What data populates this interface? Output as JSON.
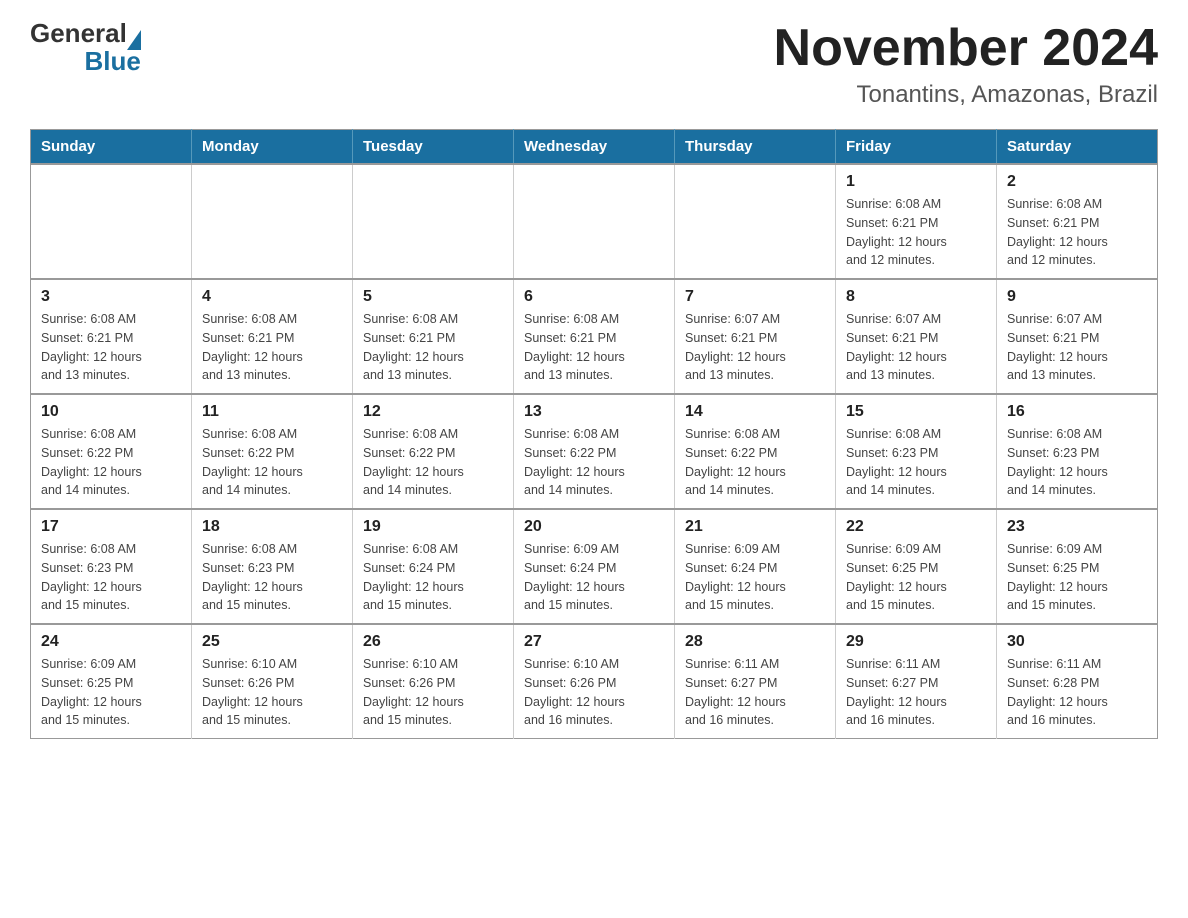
{
  "header": {
    "logo_general": "General",
    "logo_blue": "Blue",
    "title": "November 2024",
    "subtitle": "Tonantins, Amazonas, Brazil"
  },
  "days_of_week": [
    "Sunday",
    "Monday",
    "Tuesday",
    "Wednesday",
    "Thursday",
    "Friday",
    "Saturday"
  ],
  "weeks": [
    [
      {
        "day": "",
        "info": ""
      },
      {
        "day": "",
        "info": ""
      },
      {
        "day": "",
        "info": ""
      },
      {
        "day": "",
        "info": ""
      },
      {
        "day": "",
        "info": ""
      },
      {
        "day": "1",
        "info": "Sunrise: 6:08 AM\nSunset: 6:21 PM\nDaylight: 12 hours\nand 12 minutes."
      },
      {
        "day": "2",
        "info": "Sunrise: 6:08 AM\nSunset: 6:21 PM\nDaylight: 12 hours\nand 12 minutes."
      }
    ],
    [
      {
        "day": "3",
        "info": "Sunrise: 6:08 AM\nSunset: 6:21 PM\nDaylight: 12 hours\nand 13 minutes."
      },
      {
        "day": "4",
        "info": "Sunrise: 6:08 AM\nSunset: 6:21 PM\nDaylight: 12 hours\nand 13 minutes."
      },
      {
        "day": "5",
        "info": "Sunrise: 6:08 AM\nSunset: 6:21 PM\nDaylight: 12 hours\nand 13 minutes."
      },
      {
        "day": "6",
        "info": "Sunrise: 6:08 AM\nSunset: 6:21 PM\nDaylight: 12 hours\nand 13 minutes."
      },
      {
        "day": "7",
        "info": "Sunrise: 6:07 AM\nSunset: 6:21 PM\nDaylight: 12 hours\nand 13 minutes."
      },
      {
        "day": "8",
        "info": "Sunrise: 6:07 AM\nSunset: 6:21 PM\nDaylight: 12 hours\nand 13 minutes."
      },
      {
        "day": "9",
        "info": "Sunrise: 6:07 AM\nSunset: 6:21 PM\nDaylight: 12 hours\nand 13 minutes."
      }
    ],
    [
      {
        "day": "10",
        "info": "Sunrise: 6:08 AM\nSunset: 6:22 PM\nDaylight: 12 hours\nand 14 minutes."
      },
      {
        "day": "11",
        "info": "Sunrise: 6:08 AM\nSunset: 6:22 PM\nDaylight: 12 hours\nand 14 minutes."
      },
      {
        "day": "12",
        "info": "Sunrise: 6:08 AM\nSunset: 6:22 PM\nDaylight: 12 hours\nand 14 minutes."
      },
      {
        "day": "13",
        "info": "Sunrise: 6:08 AM\nSunset: 6:22 PM\nDaylight: 12 hours\nand 14 minutes."
      },
      {
        "day": "14",
        "info": "Sunrise: 6:08 AM\nSunset: 6:22 PM\nDaylight: 12 hours\nand 14 minutes."
      },
      {
        "day": "15",
        "info": "Sunrise: 6:08 AM\nSunset: 6:23 PM\nDaylight: 12 hours\nand 14 minutes."
      },
      {
        "day": "16",
        "info": "Sunrise: 6:08 AM\nSunset: 6:23 PM\nDaylight: 12 hours\nand 14 minutes."
      }
    ],
    [
      {
        "day": "17",
        "info": "Sunrise: 6:08 AM\nSunset: 6:23 PM\nDaylight: 12 hours\nand 15 minutes."
      },
      {
        "day": "18",
        "info": "Sunrise: 6:08 AM\nSunset: 6:23 PM\nDaylight: 12 hours\nand 15 minutes."
      },
      {
        "day": "19",
        "info": "Sunrise: 6:08 AM\nSunset: 6:24 PM\nDaylight: 12 hours\nand 15 minutes."
      },
      {
        "day": "20",
        "info": "Sunrise: 6:09 AM\nSunset: 6:24 PM\nDaylight: 12 hours\nand 15 minutes."
      },
      {
        "day": "21",
        "info": "Sunrise: 6:09 AM\nSunset: 6:24 PM\nDaylight: 12 hours\nand 15 minutes."
      },
      {
        "day": "22",
        "info": "Sunrise: 6:09 AM\nSunset: 6:25 PM\nDaylight: 12 hours\nand 15 minutes."
      },
      {
        "day": "23",
        "info": "Sunrise: 6:09 AM\nSunset: 6:25 PM\nDaylight: 12 hours\nand 15 minutes."
      }
    ],
    [
      {
        "day": "24",
        "info": "Sunrise: 6:09 AM\nSunset: 6:25 PM\nDaylight: 12 hours\nand 15 minutes."
      },
      {
        "day": "25",
        "info": "Sunrise: 6:10 AM\nSunset: 6:26 PM\nDaylight: 12 hours\nand 15 minutes."
      },
      {
        "day": "26",
        "info": "Sunrise: 6:10 AM\nSunset: 6:26 PM\nDaylight: 12 hours\nand 15 minutes."
      },
      {
        "day": "27",
        "info": "Sunrise: 6:10 AM\nSunset: 6:26 PM\nDaylight: 12 hours\nand 16 minutes."
      },
      {
        "day": "28",
        "info": "Sunrise: 6:11 AM\nSunset: 6:27 PM\nDaylight: 12 hours\nand 16 minutes."
      },
      {
        "day": "29",
        "info": "Sunrise: 6:11 AM\nSunset: 6:27 PM\nDaylight: 12 hours\nand 16 minutes."
      },
      {
        "day": "30",
        "info": "Sunrise: 6:11 AM\nSunset: 6:28 PM\nDaylight: 12 hours\nand 16 minutes."
      }
    ]
  ]
}
